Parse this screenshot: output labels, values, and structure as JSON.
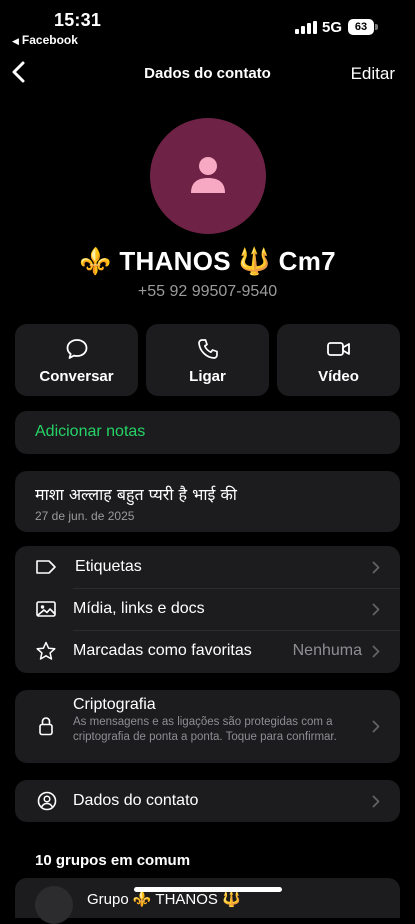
{
  "status": {
    "time": "15:31",
    "back_app": "Facebook",
    "network": "5G",
    "battery": "63"
  },
  "nav": {
    "title": "Dados do contato",
    "edit": "Editar"
  },
  "contact": {
    "name": "⚜️ THANOS 🔱 Cm7",
    "phone": "+55 92 99507-9540"
  },
  "actions": [
    {
      "label": "Conversar",
      "icon": "chat-bubble-icon"
    },
    {
      "label": "Ligar",
      "icon": "phone-icon"
    },
    {
      "label": "Vídeo",
      "icon": "video-camera-icon"
    }
  ],
  "notes": {
    "label": "Adicionar notas"
  },
  "about": {
    "text": "माशा अल्लाह बहुत प्यरी है भाई की",
    "date": "27 de jun. de 2025"
  },
  "menu": {
    "labels": "Etiquetas",
    "media": "Mídia, links e docs",
    "starred": "Marcadas como favoritas",
    "starred_value": "Nenhuma"
  },
  "encryption": {
    "title": "Criptografia",
    "desc": "As mensagens e as ligações são protegidas com a criptografia de ponta a ponta. Toque para confirmar."
  },
  "contact_details": {
    "label": "Dados do contato"
  },
  "groups": {
    "header": "10 grupos em comum",
    "first_group_visible": "Grupo ⚜️ THANOS 🔱"
  },
  "colors": {
    "accent_green": "#25d366",
    "card_bg": "#1c1c1e",
    "avatar_bg": "#6d2246",
    "avatar_icon": "#f7a8c2"
  }
}
